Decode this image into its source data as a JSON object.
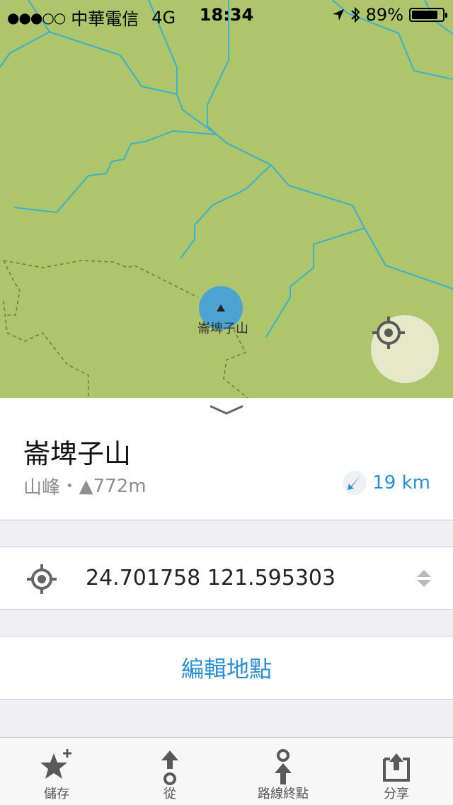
{
  "status_bar": {
    "signal": "●●●○○",
    "carrier": "中華電信",
    "network": "4G",
    "time": "18:34",
    "battery_percent": "89%",
    "battery_level": 0.89
  },
  "map": {
    "poi_label": "崙埤子山",
    "land_color": "#aec56c",
    "river_color": "#36b3cf",
    "poi_color": "#4ca4d2"
  },
  "place": {
    "name": "崙埤子山",
    "category": "山峰",
    "separator": "•",
    "elevation": "▲772m",
    "distance": "19 km"
  },
  "coordinates": {
    "value": "24.701758 121.595303"
  },
  "edit": {
    "label": "編輯地點"
  },
  "tabbar": {
    "items": [
      {
        "label": "儲存",
        "icon": "star-plus-icon"
      },
      {
        "label": "從",
        "icon": "route-from-icon"
      },
      {
        "label": "路線終點",
        "icon": "route-to-icon"
      },
      {
        "label": "分享",
        "icon": "share-icon"
      }
    ]
  },
  "colors": {
    "accent": "#2a8fd8",
    "grey_text": "#8e8e93"
  }
}
